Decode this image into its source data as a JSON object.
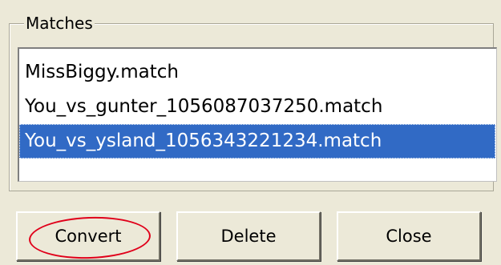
{
  "group": {
    "title": "Matches"
  },
  "matches": {
    "items": [
      {
        "label": "MissBiggy.match",
        "selected": false
      },
      {
        "label": "You_vs_gunter_1056087037250.match",
        "selected": false
      },
      {
        "label": "You_vs_ysland_1056343221234.match",
        "selected": true
      }
    ]
  },
  "buttons": {
    "convert_label": "Convert",
    "delete_label": "Delete",
    "close_label": "Close"
  },
  "annotation": {
    "circle_color": "#e0001a",
    "target": "convert-button"
  },
  "colors": {
    "background": "#ece9d8",
    "selection": "#316ac5"
  }
}
